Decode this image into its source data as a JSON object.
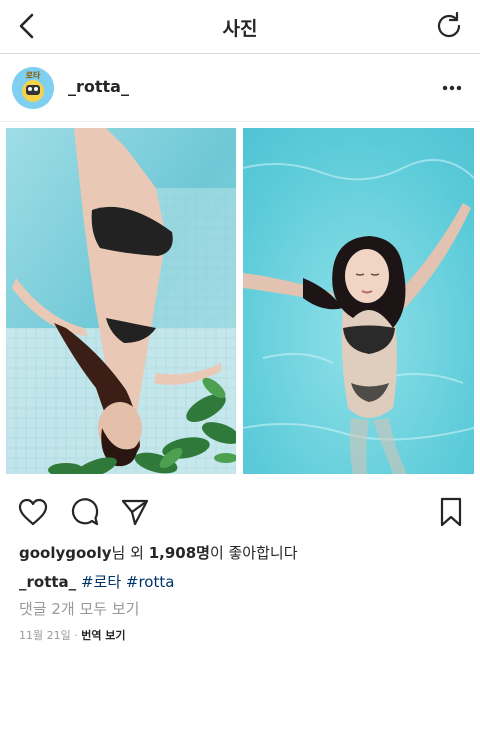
{
  "nav": {
    "title": "사진"
  },
  "post": {
    "username": "_rotta_",
    "avatar_text": "로타"
  },
  "likes": {
    "user": "goolygooly",
    "mid": "님 외 ",
    "count": "1,908명",
    "suffix": "이 좋아합니다"
  },
  "caption": {
    "username": "_rotta_",
    "tag1": "#로타",
    "tag2": "#rotta"
  },
  "comments": {
    "label": "댓글 2개 모두 보기"
  },
  "meta": {
    "date": "11월 21일",
    "sep": " · ",
    "translate": "번역 보기"
  },
  "icons": {
    "back": "chevron-left-icon",
    "refresh": "refresh-icon",
    "more": "more-icon",
    "like": "heart-icon",
    "comment": "comment-icon",
    "share": "send-icon",
    "save": "bookmark-icon"
  },
  "colors": {
    "link": "#003569",
    "muted": "#999999",
    "text": "#262626",
    "divider": "#dbdbdb"
  }
}
